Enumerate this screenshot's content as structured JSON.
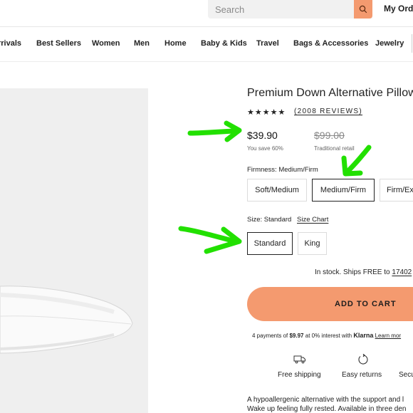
{
  "header": {
    "search_placeholder": "Search",
    "orders_label": "My Orde",
    "search_icon": "search-icon"
  },
  "nav": {
    "items": [
      "rrivals",
      "Best Sellers",
      "Women",
      "Men",
      "Home",
      "Baby & Kids",
      "Travel",
      "Bags & Accessories",
      "Jewelry"
    ]
  },
  "product": {
    "title": "Premium Down Alternative Pillow",
    "stars": "★★★★★",
    "reviews_link": "(2008 REVIEWS)",
    "price": "$39.90",
    "savings": "You save 60%",
    "original_price": "$99.00",
    "original_label": "Traditional retail",
    "firmness": {
      "label": "Firmness: Medium/Firm",
      "options": [
        "Soft/Medium",
        "Medium/Firm",
        "Firm/Ex"
      ],
      "selected": "Medium/Firm"
    },
    "size": {
      "label": "Size: Standard",
      "chart_link": "Size Chart",
      "options": [
        "Standard",
        "King"
      ],
      "selected": "Standard"
    },
    "stock_text": "In stock. Ships FREE to",
    "zip": "17402",
    "add_to_cart": "ADD TO CART",
    "klarna": {
      "prefix": "4 payments of",
      "amount": "$9.97",
      "middle": "at 0% interest with",
      "logo": "Klarna",
      "learn_more": "Learn mor"
    },
    "features": [
      {
        "label": "Free shipping",
        "icon": "truck-icon"
      },
      {
        "label": "Easy returns",
        "icon": "return-arrow-icon"
      },
      {
        "label": "Secu",
        "icon": "shield-icon"
      }
    ],
    "description_lines": [
      "A hypoallergenic alternative with the support and l",
      "Wake up feeling fully rested. Available in three den"
    ]
  },
  "colors": {
    "accent": "#f49a6f",
    "annotation_arrow": "#22e000",
    "image_bg": "#efefef"
  }
}
